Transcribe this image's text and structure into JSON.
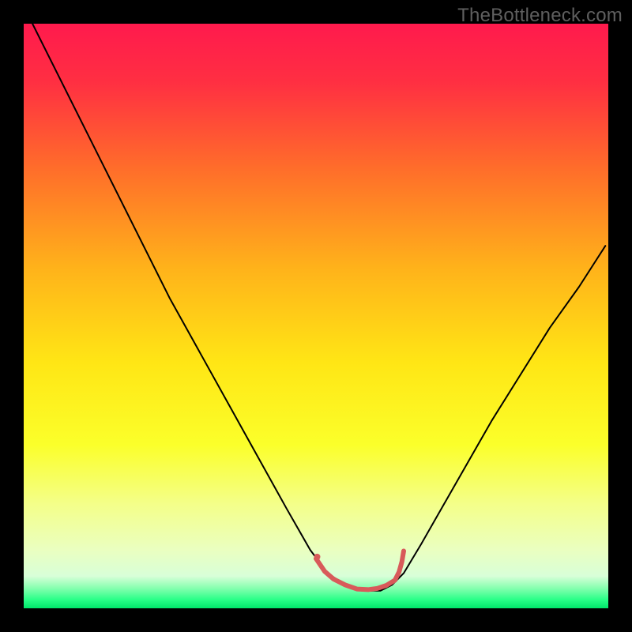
{
  "watermark": "TheBottleneck.com",
  "chart_data": {
    "type": "line",
    "title": "",
    "xlabel": "",
    "ylabel": "",
    "x_range": [
      0,
      100
    ],
    "y_range": [
      0,
      100
    ],
    "gradient_stops": [
      {
        "offset": 0.0,
        "color": "#ff1a4d"
      },
      {
        "offset": 0.1,
        "color": "#ff2f42"
      },
      {
        "offset": 0.25,
        "color": "#ff6e2a"
      },
      {
        "offset": 0.42,
        "color": "#ffb31a"
      },
      {
        "offset": 0.58,
        "color": "#ffe615"
      },
      {
        "offset": 0.72,
        "color": "#fbff2a"
      },
      {
        "offset": 0.82,
        "color": "#f4ff88"
      },
      {
        "offset": 0.9,
        "color": "#eaffc0"
      },
      {
        "offset": 0.945,
        "color": "#d8ffd8"
      },
      {
        "offset": 0.965,
        "color": "#88ffb0"
      },
      {
        "offset": 0.985,
        "color": "#2aff88"
      },
      {
        "offset": 1.0,
        "color": "#00e66a"
      }
    ],
    "series": [
      {
        "name": "bottleneck-curve",
        "color": "#000000",
        "width": 2,
        "x": [
          1.5,
          5,
          10,
          15,
          20,
          25,
          30,
          35,
          40,
          45,
          49,
          52,
          55,
          58,
          61,
          63,
          65,
          68,
          72,
          76,
          80,
          85,
          90,
          95,
          99.5
        ],
        "y": [
          100,
          93,
          83,
          73,
          63,
          53,
          44,
          35,
          26,
          17,
          10,
          6,
          4,
          3,
          3,
          4,
          6,
          11,
          18,
          25,
          32,
          40,
          48,
          55,
          62
        ]
      },
      {
        "name": "optimal-band",
        "color": "#d85a5a",
        "width": 6,
        "x": [
          50,
          51.5,
          53,
          55,
          57,
          59,
          60.5,
          62,
          63.5,
          64.2,
          64.7,
          65
        ],
        "y": [
          8.5,
          6.3,
          5.0,
          4.0,
          3.3,
          3.2,
          3.4,
          3.9,
          4.8,
          6.2,
          8.0,
          9.8
        ]
      },
      {
        "name": "optimal-start-dot",
        "type": "marker",
        "color": "#d85a5a",
        "x": 50.2,
        "y": 8.8,
        "r": 4
      }
    ]
  }
}
